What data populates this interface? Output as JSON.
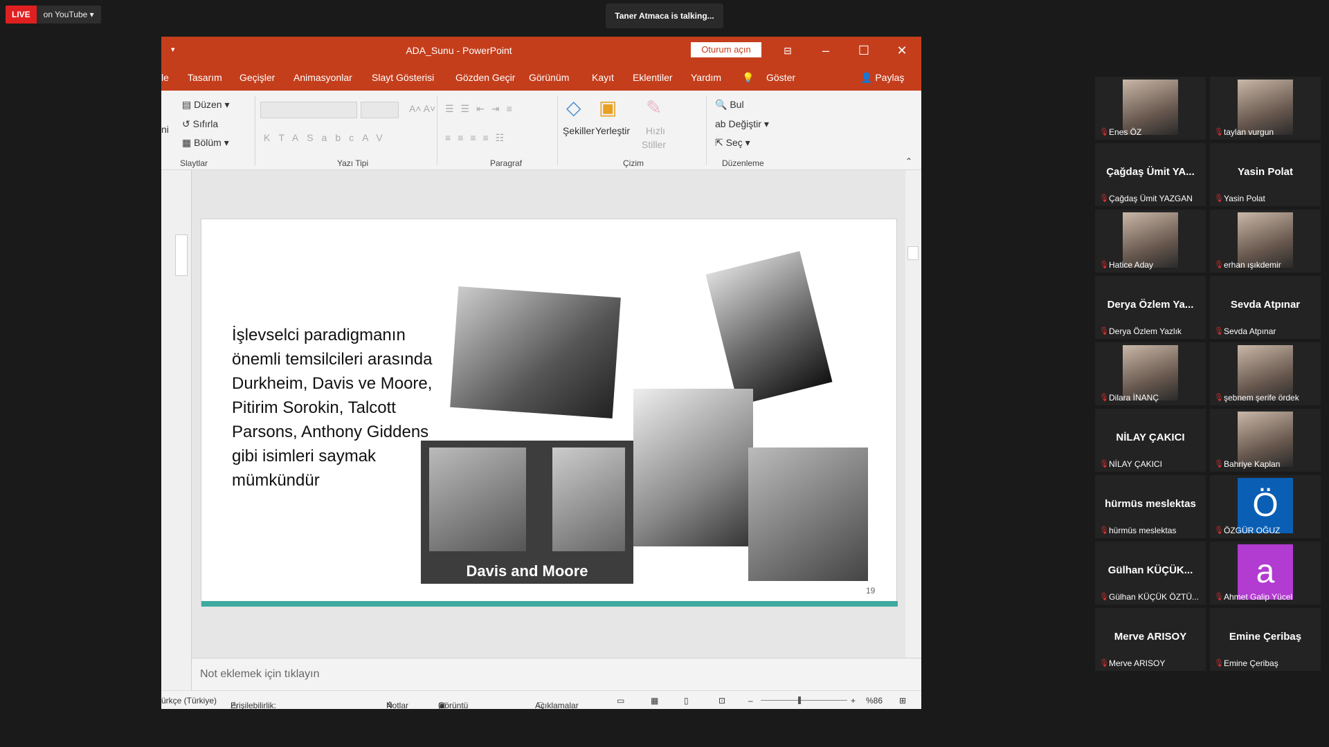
{
  "live": {
    "badge": "LIVE",
    "platform": "on YouTube ▾"
  },
  "talking": "Taner Atmaca is talking...",
  "ppt": {
    "title": "ADA_Sunu  -  PowerPoint",
    "signin": "Oturum açın",
    "menu": [
      "le",
      "Tasarım",
      "Geçişler",
      "Animasyonlar",
      "Slayt Gösterisi",
      "Gözden Geçir",
      "Görünüm",
      "Kayıt",
      "Eklentiler",
      "Yardım",
      "Göster",
      "Paylaş"
    ],
    "ribbon": {
      "duzen": "Düzen",
      "sifirla": "Sıfırla",
      "bolum": "Bölüm",
      "slaytlar": "Slaytlar",
      "yazitipi": "Yazı Tipi",
      "paragraf": "Paragraf",
      "sekiller": "Şekiller",
      "yerlestir": "Yerleştir",
      "hizli": "Hızlı",
      "stiller": "Stiller",
      "cizim": "Çizim",
      "bul": "Bul",
      "degistir": "Değiştir",
      "sec": "Seç",
      "duzenleme": "Düzenleme"
    },
    "slide": {
      "text": "İşlevselci paradigmanın önemli temsilcileri arasında Durkheim, Davis ve Moore, Pitirim Sorokin, Talcott Parsons, Anthony Giddens gibi isimleri saymak mümkündür",
      "caption": "Davis and Moore",
      "number": "19"
    },
    "notes": "Not eklemek için tıklayın",
    "status": {
      "lang": "ürkçe (Türkiye)",
      "access": "Erişilebilirlik: Önerilere göz atın",
      "notlar": "Notlar",
      "goruntu": "Görüntü Ayarları",
      "aciklamalar": "Açıklamalar",
      "zoom": "%86"
    }
  },
  "participants": [
    {
      "big": "",
      "name": "Enes ÖZ"
    },
    {
      "big": "",
      "name": "taylan vurgun"
    },
    {
      "big": "Çağdaş Ümit YA...",
      "name": "Çağdaş Ümit YAZGAN"
    },
    {
      "big": "Yasin Polat",
      "name": "Yasin Polat"
    },
    {
      "big": "",
      "name": "Hatice Aday"
    },
    {
      "big": "",
      "name": "erhan ışıkdemir"
    },
    {
      "big": "Derya Özlem Ya...",
      "name": "Derya Özlem Yazlık"
    },
    {
      "big": "Sevda Atpınar",
      "name": "Sevda Atpınar"
    },
    {
      "big": "",
      "name": "Dilara İNANÇ"
    },
    {
      "big": "",
      "name": "şebnem şerife ördek"
    },
    {
      "big": "NİLAY ÇAKICI",
      "name": "NİLAY ÇAKICI"
    },
    {
      "big": "",
      "name": "Bahriye Kaplan"
    },
    {
      "big": "hürmüs meslektas",
      "name": "hürmüs meslektas"
    },
    {
      "big": "",
      "name": "ÖZGÜR OĞUZ",
      "letter": "Ö",
      "color": "#0a5fb4"
    },
    {
      "big": "Gülhan  KÜÇÜK...",
      "name": "Gülhan KÜÇÜK ÖZTÜ..."
    },
    {
      "big": "",
      "name": "Ahmet Galip Yücel",
      "letter": "a",
      "color": "#b23bd1"
    },
    {
      "big": "Merve ARISOY",
      "name": "Merve ARISOY"
    },
    {
      "big": "Emine Çeribaş",
      "name": "Emine Çeribaş"
    }
  ]
}
